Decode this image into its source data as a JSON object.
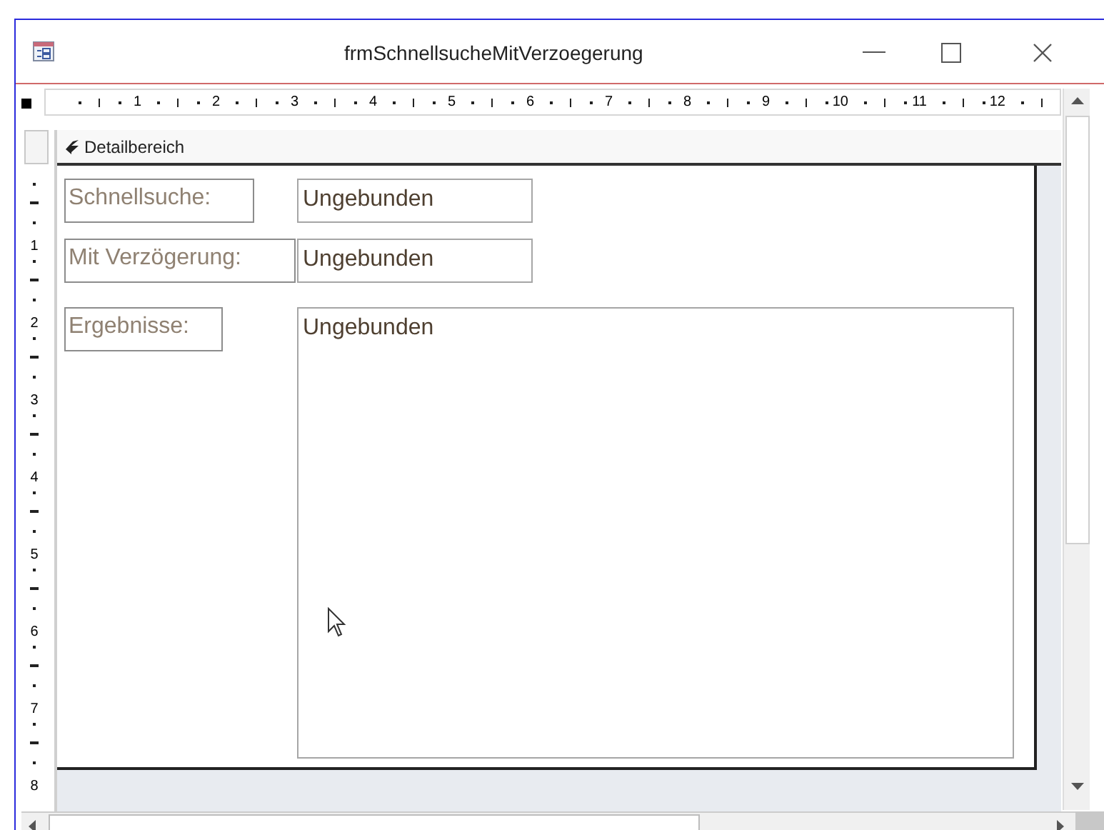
{
  "window": {
    "title": "frmSchnellsucheMitVerzoegerung"
  },
  "horizontal_ruler": [
    "1",
    "2",
    "3",
    "4",
    "5",
    "6",
    "7",
    "8",
    "9",
    "10",
    "11",
    "12"
  ],
  "vertical_ruler": [
    "1",
    "2",
    "3",
    "4",
    "5",
    "6",
    "7",
    "8"
  ],
  "section": {
    "title": "Detailbereich"
  },
  "controls": [
    {
      "label": "Schnellsuche:",
      "value": "Ungebunden",
      "kind": "textbox"
    },
    {
      "label": "Mit Verzögerung:",
      "value": "Ungebunden",
      "kind": "textbox"
    },
    {
      "label": "Ergebnisse:",
      "value": "Ungebunden",
      "kind": "listbox"
    }
  ]
}
